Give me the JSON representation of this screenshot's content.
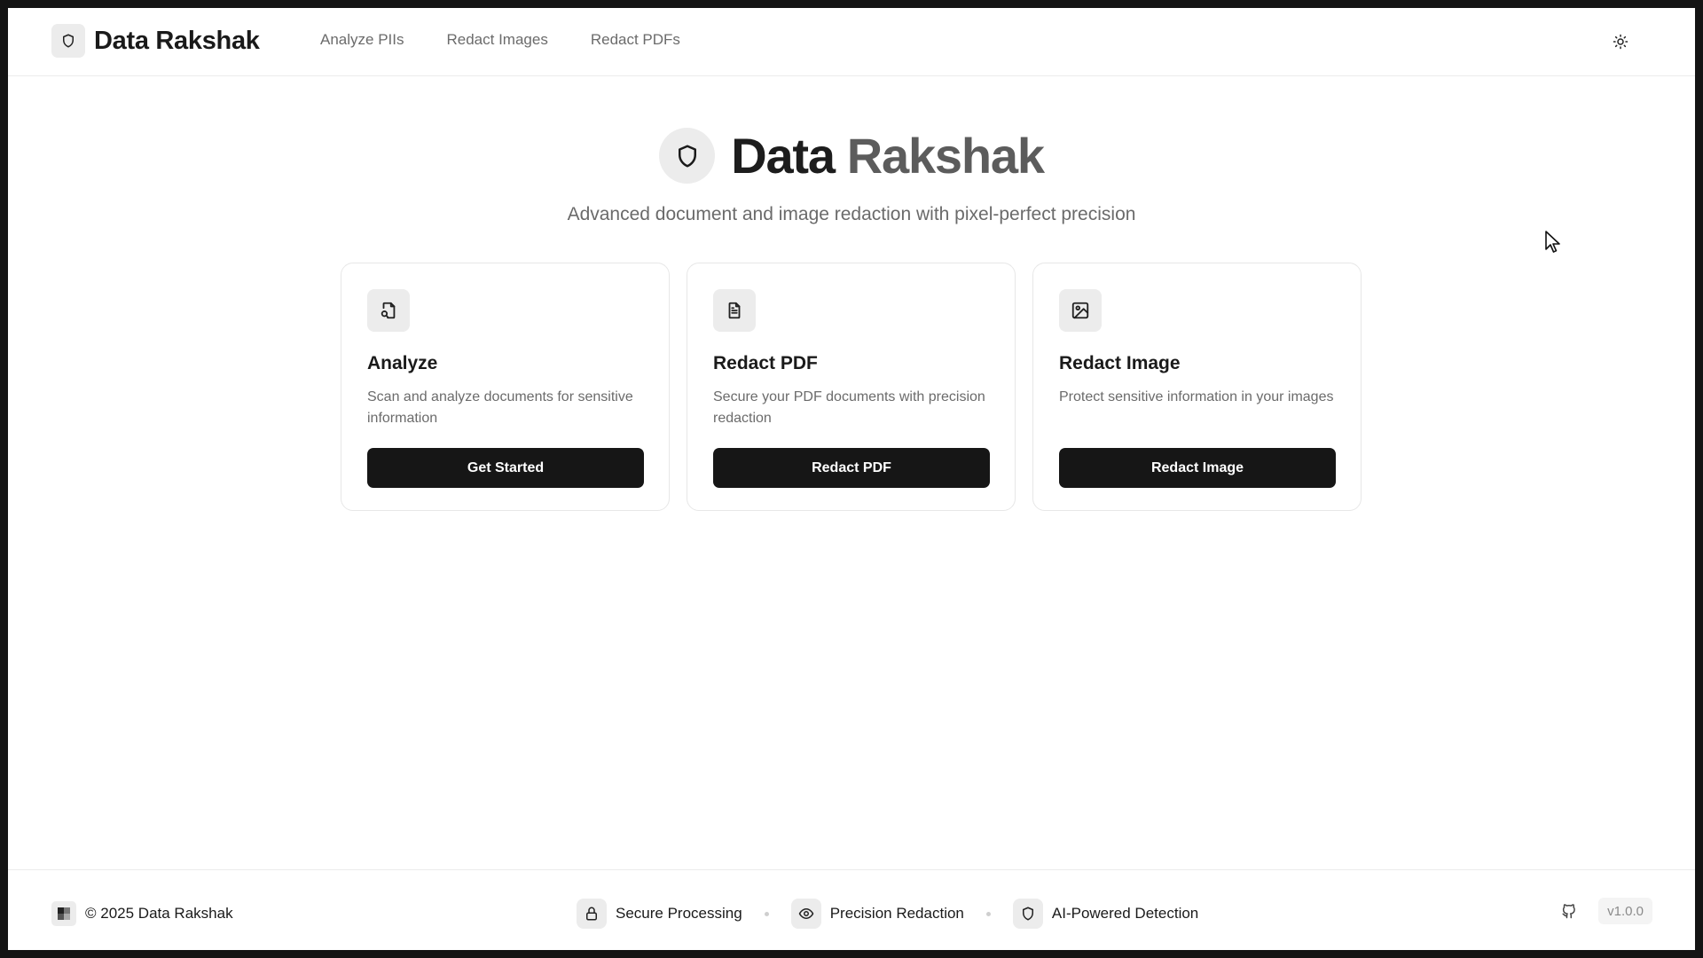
{
  "header": {
    "brand": "Data Rakshak",
    "brand_icon": "shield-icon",
    "nav": [
      "Analyze PIIs",
      "Redact Images",
      "Redact PDFs"
    ],
    "theme_icon": "sun-icon"
  },
  "hero": {
    "title_part1": "Data",
    "title_part2": "Rakshak",
    "subtitle": "Advanced document and image redaction with pixel-perfect precision",
    "icon": "shield-icon"
  },
  "cards": [
    {
      "icon": "file-search-icon",
      "title": "Analyze",
      "description": "Scan and analyze documents for sensitive information",
      "button": "Get Started"
    },
    {
      "icon": "file-text-icon",
      "title": "Redact PDF",
      "description": "Secure your PDF documents with precision redaction",
      "button": "Redact PDF"
    },
    {
      "icon": "image-icon",
      "title": "Redact Image",
      "description": "Protect sensitive information in your images",
      "button": "Redact Image"
    }
  ],
  "footer": {
    "copyright": "© 2025 Data Rakshak",
    "features": [
      {
        "icon": "lock-icon",
        "label": "Secure Processing"
      },
      {
        "icon": "eye-icon",
        "label": "Precision Redaction"
      },
      {
        "icon": "shield-icon",
        "label": "AI-Powered Detection"
      }
    ],
    "version": "v1.0.0",
    "github_icon": "github-icon"
  },
  "colors": {
    "accent": "#161616",
    "muted_text": "#6b6b6b",
    "icon_bg": "#ececec"
  }
}
